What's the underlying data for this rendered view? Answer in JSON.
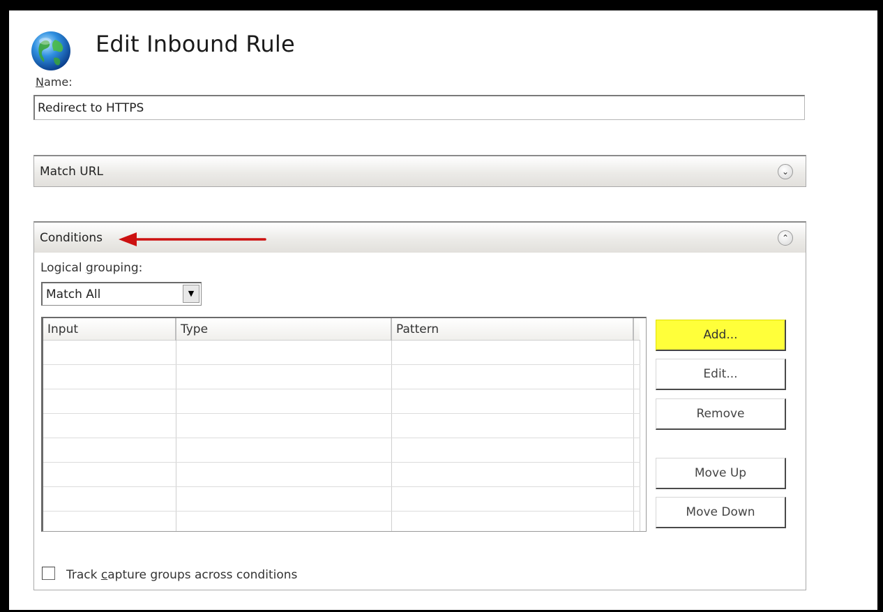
{
  "header": {
    "title": "Edit Inbound Rule"
  },
  "name_field": {
    "label_accel": "N",
    "label_rest": "ame:",
    "value": "Redirect to HTTPS"
  },
  "match_url": {
    "label": "Match URL",
    "expand_icon": "chevron-down-icon"
  },
  "conditions": {
    "label": "Conditions",
    "collapse_icon": "chevron-up-icon",
    "logical_grouping_pre": "Logical ",
    "logical_grouping_accel": "g",
    "logical_grouping_post": "rouping:",
    "logical_grouping_value": "Match All",
    "columns": [
      "Input",
      "Type",
      "Pattern"
    ],
    "rows": [],
    "buttons": {
      "add": "Add...",
      "edit": "Edit...",
      "remove": "Remove",
      "move_up": "Move Up",
      "move_down": "Move Down"
    },
    "track_pre": "Track ",
    "track_accel": "c",
    "track_post": "apture groups across conditions",
    "track_checked": false
  },
  "colors": {
    "highlight_button": "#ffff3a",
    "annotation_arrow": "#cc1111"
  }
}
